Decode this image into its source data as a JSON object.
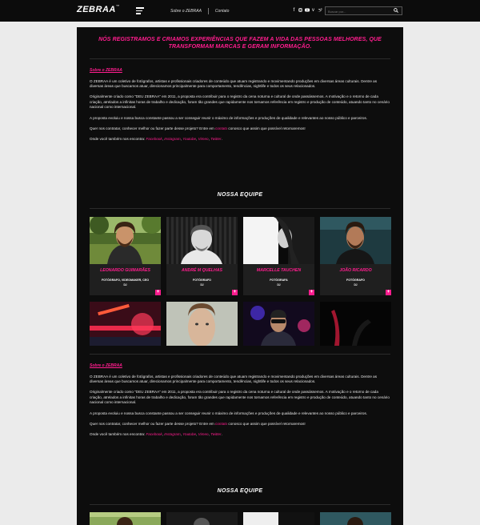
{
  "header": {
    "logo": "ZEBRAA",
    "logo_mark": "™",
    "nav": [
      "Sobre o ZEBRAA",
      "Contato"
    ],
    "social_icons": [
      "facebook-icon",
      "instagram-icon",
      "youtube-icon",
      "vimeo-icon",
      "twitter-icon"
    ],
    "search_placeholder": "Buscar por..."
  },
  "hero": "NÓS REGISTRAMOS E CRIAMOS EXPERIÊNCIAS QUE FAZEM A VIDA DAS PESSOAS MELHORES, QUE TRANSFORMAM MARCAS E GERAM INFORMAÇÃO.",
  "about": {
    "title": "Sobre o ZEBRAA",
    "p1": "O ZEBRAA é um coletivo de fotógrafos, artistas e profissionais criadores de conteúdo que atuam registrando e movimentando produções em diversas áreas culturais. Dentre as diversas áreas que buscamos atuar, direcionamos principalmente para comportamento, tendências, nightlife e todos os seus relacionados.",
    "p2": "Originalmente criado como \"DEU ZEBRAA\" em 2011, a proposta era contribuir para o registro da cena noturna e cultural de onde passássemos. A motivação e o retorno de cada criação, atrelados a infinitas horas de trabalho e dedicação, foram tão grandes que rapidamente nos tornamos referência em registro e produção de conteúdo, atuando tanto no cenário nacional como internacional.",
    "p3": "A proposta evoluiu e nossa busca constante passou a ser conseguir reunir o máximo de informações e produções de qualidade e relevantes ao nosso público e parceiros.",
    "p4_before": "Quer nos contratar, conhecer melhor ou fazer parte desse projeto? Entre em ",
    "p4_link": "contato",
    "p4_after": " conosco que assim que possível retornaremos!",
    "p5_before": "Onde você também nos encontra: ",
    "links": [
      "Facebook",
      "Instagram",
      "Youtube",
      "Vimeo",
      "Twitter"
    ],
    "comma": ", ",
    "period": "."
  },
  "team": {
    "title": "NOSSA EQUIPE",
    "members": [
      {
        "name": "LEONARDO GUIMARÃES",
        "role": "FOTÓGRAFO, VIDEOMAKER, CEO",
        "tag": "DJ"
      },
      {
        "name": "ANDRÉ M QUELHAS",
        "role": "FOTÓGRAFO",
        "tag": "DJ"
      },
      {
        "name": "MARCELLE TAUCHEN",
        "role": "FOTÓGRAFA",
        "tag": "DJ"
      },
      {
        "name": "JOÃO RICARDO",
        "role": "FOTÓGRAFO",
        "tag": "DJ"
      }
    ],
    "plus": "+"
  },
  "colors": {
    "accent": "#ff1d8e",
    "panel": "#0d0d0d",
    "page": "#ebebeb"
  }
}
